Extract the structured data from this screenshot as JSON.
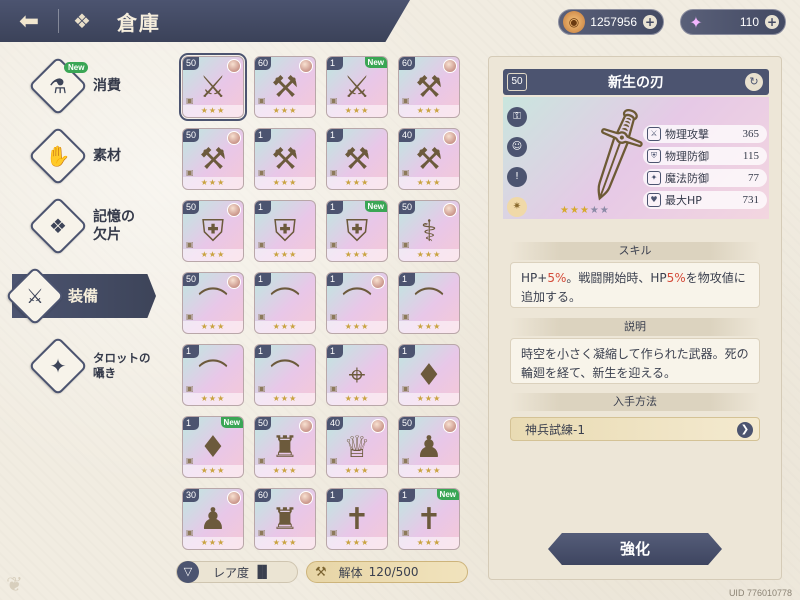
{
  "header": {
    "title": "倉庫",
    "back_icon": "back-arrow-icon",
    "home_icon": "grid-icon"
  },
  "currencies": [
    {
      "name": "gold-coin",
      "value": "1257956"
    },
    {
      "name": "star-gem",
      "value": "110"
    }
  ],
  "sidebar": {
    "items": [
      {
        "label": "消費",
        "icon": "potion-icon",
        "new": "New",
        "active": false
      },
      {
        "label": "素材",
        "icon": "material-icon",
        "new": "",
        "active": false
      },
      {
        "label_line1": "記憶の",
        "label_line2": "欠片",
        "icon": "puzzle-icon",
        "new": "",
        "active": false
      },
      {
        "label": "装備",
        "icon": "equipment-icon",
        "new": "",
        "active": true
      },
      {
        "label_line1": "タロットの",
        "label_line2": "囁き",
        "icon": "tarot-icon",
        "new": "",
        "active": false
      }
    ]
  },
  "grid": {
    "items": [
      {
        "level": "50",
        "art": "sword",
        "stars": 3,
        "new": "",
        "char": true,
        "selected": true
      },
      {
        "level": "60",
        "art": "halberd",
        "stars": 3,
        "new": "",
        "char": true
      },
      {
        "level": "1",
        "art": "sword",
        "stars": 3,
        "new": "New",
        "char": false
      },
      {
        "level": "60",
        "art": "axe",
        "stars": 3,
        "new": "",
        "char": true
      },
      {
        "level": "50",
        "art": "axe",
        "stars": 3,
        "new": "",
        "char": true
      },
      {
        "level": "1",
        "art": "axe",
        "stars": 3,
        "new": "",
        "char": false
      },
      {
        "level": "1",
        "art": "axe",
        "stars": 3,
        "new": "",
        "char": false
      },
      {
        "level": "40",
        "art": "axe",
        "stars": 3,
        "new": "",
        "char": true
      },
      {
        "level": "50",
        "art": "shield",
        "stars": 3,
        "new": "",
        "char": true
      },
      {
        "level": "1",
        "art": "shield",
        "stars": 3,
        "new": "",
        "char": false
      },
      {
        "level": "1",
        "art": "shield",
        "stars": 3,
        "new": "New",
        "char": false
      },
      {
        "level": "50",
        "art": "staff",
        "stars": 3,
        "new": "",
        "char": true
      },
      {
        "level": "50",
        "art": "bow",
        "stars": 3,
        "new": "",
        "char": true
      },
      {
        "level": "1",
        "art": "bow",
        "stars": 3,
        "new": "",
        "char": false
      },
      {
        "level": "1",
        "art": "bow",
        "stars": 3,
        "new": "",
        "char": true
      },
      {
        "level": "1",
        "art": "bow",
        "stars": 3,
        "new": "",
        "char": false
      },
      {
        "level": "1",
        "art": "bow",
        "stars": 3,
        "new": "",
        "char": false
      },
      {
        "level": "1",
        "art": "bow",
        "stars": 3,
        "new": "",
        "char": false
      },
      {
        "level": "1",
        "art": "crossbow",
        "stars": 3,
        "new": "",
        "char": false
      },
      {
        "level": "1",
        "art": "crystal",
        "stars": 3,
        "new": "",
        "char": false
      },
      {
        "level": "1",
        "art": "crystal",
        "stars": 3,
        "new": "New",
        "char": false
      },
      {
        "level": "50",
        "art": "armor",
        "stars": 3,
        "new": "",
        "char": true
      },
      {
        "level": "40",
        "art": "hat",
        "stars": 3,
        "new": "",
        "char": true
      },
      {
        "level": "50",
        "art": "robe",
        "stars": 3,
        "new": "",
        "char": true
      },
      {
        "level": "30",
        "art": "robe",
        "stars": 3,
        "new": "",
        "char": true
      },
      {
        "level": "60",
        "art": "armor",
        "stars": 3,
        "new": "",
        "char": true
      },
      {
        "level": "1",
        "art": "cross",
        "stars": 3,
        "new": "",
        "char": false
      },
      {
        "level": "1",
        "art": "cross",
        "stars": 3,
        "new": "New",
        "char": false
      }
    ]
  },
  "controls": {
    "rarity_label": "レア度",
    "dismantle_label": "解体",
    "dismantle_count": "120/500"
  },
  "detail": {
    "level": "50",
    "name": "新生の刃",
    "stars_filled": 3,
    "stars_total": 5,
    "stats": [
      {
        "label": "物理攻撃",
        "value": "365",
        "icon": "sword-icon"
      },
      {
        "label": "物理防御",
        "value": "115",
        "icon": "shield-icon"
      },
      {
        "label": "魔法防御",
        "value": "77",
        "icon": "magic-shield-icon"
      },
      {
        "label": "最大HP",
        "value": "731",
        "icon": "heart-icon"
      }
    ],
    "skill_title": "スキル",
    "skill_text_a": "HP+",
    "skill_hl1": "5%",
    "skill_text_b": "。戦闘開始時、HP",
    "skill_hl2": "5%",
    "skill_text_c": "を物攻値に追加する。",
    "desc_title": "説明",
    "desc_text": "時空を小さく凝縮して作られた武器。死の輪廻を経て、新生を迎える。",
    "source_title": "入手方法",
    "source_text": "神兵試練-1",
    "enhance_label": "強化"
  },
  "uid": "UID 776010778",
  "colors": {
    "accent": "#4c5470",
    "background": "#f1ece1",
    "highlight": "#d44b3a",
    "new_badge": "#3aa655"
  }
}
